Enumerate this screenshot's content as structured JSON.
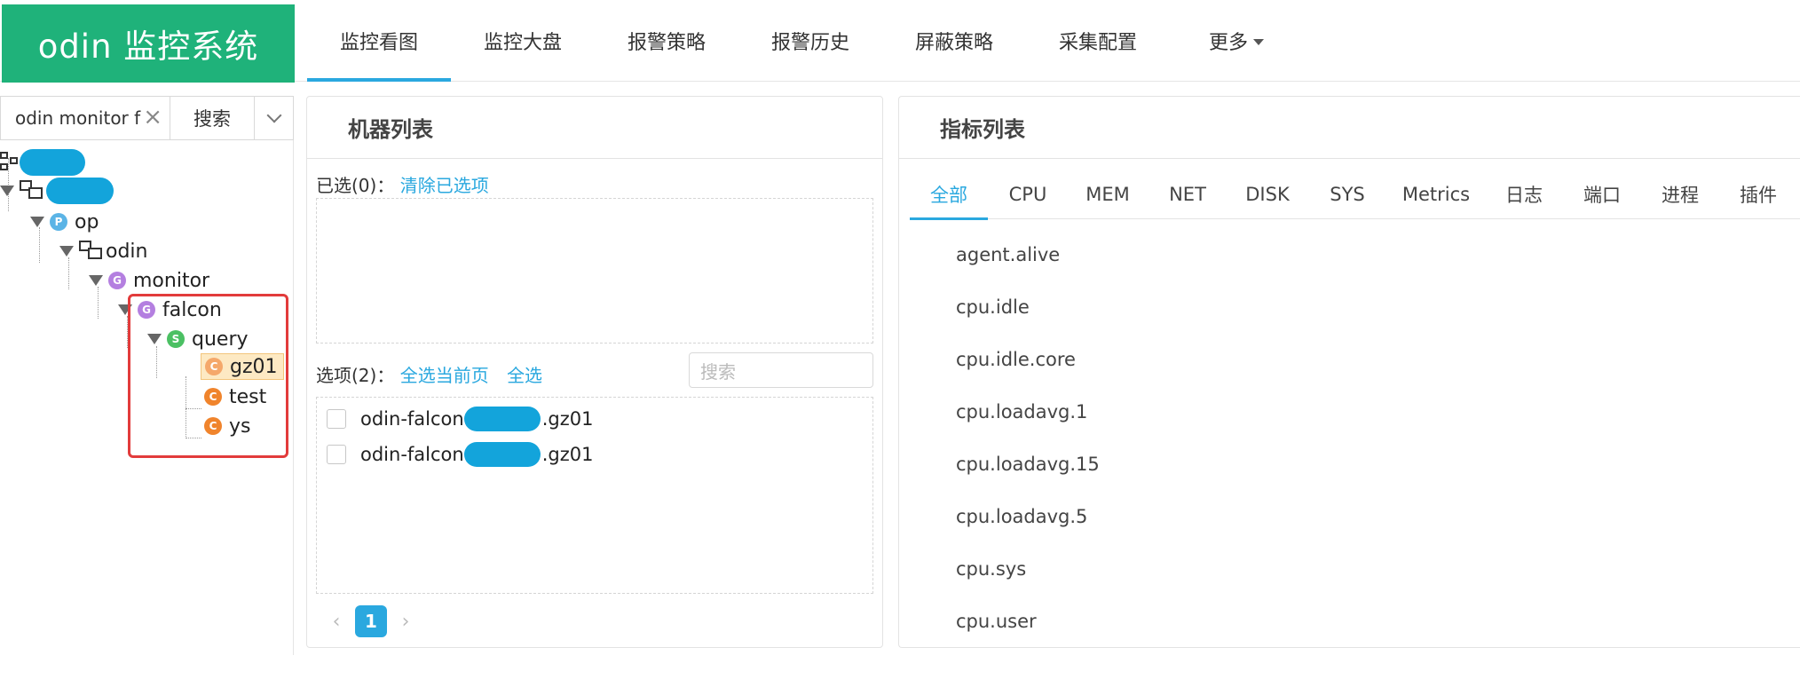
{
  "app": {
    "logo": "odin 监控系统"
  },
  "nav": [
    "监控看图",
    "监控大盘",
    "报警策略",
    "报警历史",
    "屏蔽策略",
    "采集配置",
    "更多"
  ],
  "left": {
    "search_value": "odin monitor f",
    "search_button": "搜索",
    "tree": {
      "op": "op",
      "odin": "odin",
      "monitor": "monitor",
      "falcon": "falcon",
      "query": "query",
      "gz01": "gz01",
      "test": "test",
      "ys": "ys"
    },
    "badges": {
      "p": "P",
      "g": "G",
      "s": "S",
      "c": "C"
    }
  },
  "machine_panel": {
    "title": "机器列表",
    "selected_label": "已选(0)：",
    "clear_selected": "清除已选项",
    "options_label": "选项(2)：",
    "select_page": "全选当前页",
    "select_all": "全选",
    "search_placeholder": "搜索",
    "rows": [
      {
        "prefix": "odin-falcon",
        "suffix": ".gz01"
      },
      {
        "prefix": "odin-falcon",
        "suffix": ".gz01"
      }
    ],
    "page": "1"
  },
  "metric_panel": {
    "title": "指标列表",
    "tabs": [
      "全部",
      "CPU",
      "MEM",
      "NET",
      "DISK",
      "SYS",
      "Metrics",
      "日志",
      "端口",
      "进程",
      "插件"
    ],
    "metrics": [
      "agent.alive",
      "cpu.idle",
      "cpu.idle.core",
      "cpu.loadavg.1",
      "cpu.loadavg.15",
      "cpu.loadavg.5",
      "cpu.sys",
      "cpu.user"
    ]
  },
  "colors": {
    "brand": "#1fb27a",
    "accent": "#2aa8df",
    "highlight": "#e23b3b",
    "redact": "#13a4db"
  }
}
